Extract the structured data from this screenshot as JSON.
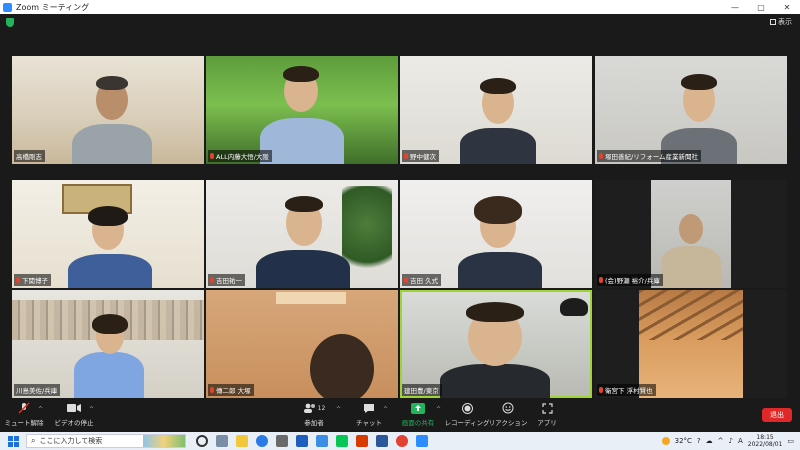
{
  "window": {
    "title": "Zoom ミーティング",
    "minimize": "—",
    "maximize": "▢",
    "close": "✕"
  },
  "view_label": "表示",
  "participants": [
    {
      "name": "高橋剛志"
    },
    {
      "name": "ALL内藤大悟/大阪"
    },
    {
      "name": "野中健次"
    },
    {
      "name": "塚田善紀/リフォーム産業新聞社"
    },
    {
      "name": "下関博子"
    },
    {
      "name": "吉田祐一"
    },
    {
      "name": "吉田 久式"
    },
    {
      "name": "(会)野瀬 裕介/兵庫"
    },
    {
      "name": "川島美佐/兵庫"
    },
    {
      "name": "傳二郎 大塚"
    },
    {
      "name": "建田豊/東京"
    },
    {
      "name": "衛宮下 浮村賢也"
    }
  ],
  "toolbar": {
    "mute": "ミュート解除",
    "video": "ビデオの停止",
    "participants": "参加者",
    "participants_count": "12",
    "chat": "チャット",
    "share": "画面の共有",
    "record": "レコーディング",
    "reactions": "リアクション",
    "apps": "アプリ",
    "leave": "退出",
    "caret": "^"
  },
  "taskbar": {
    "search_placeholder": "ここに入力して検索",
    "temperature": "32°C",
    "ime": "A",
    "time": "18:15",
    "date": "2022/08/01"
  },
  "colors": {
    "accent": "#2d8cff",
    "share": "#23b35c",
    "leave": "#e02828",
    "active_speaker": "#9fd336"
  }
}
